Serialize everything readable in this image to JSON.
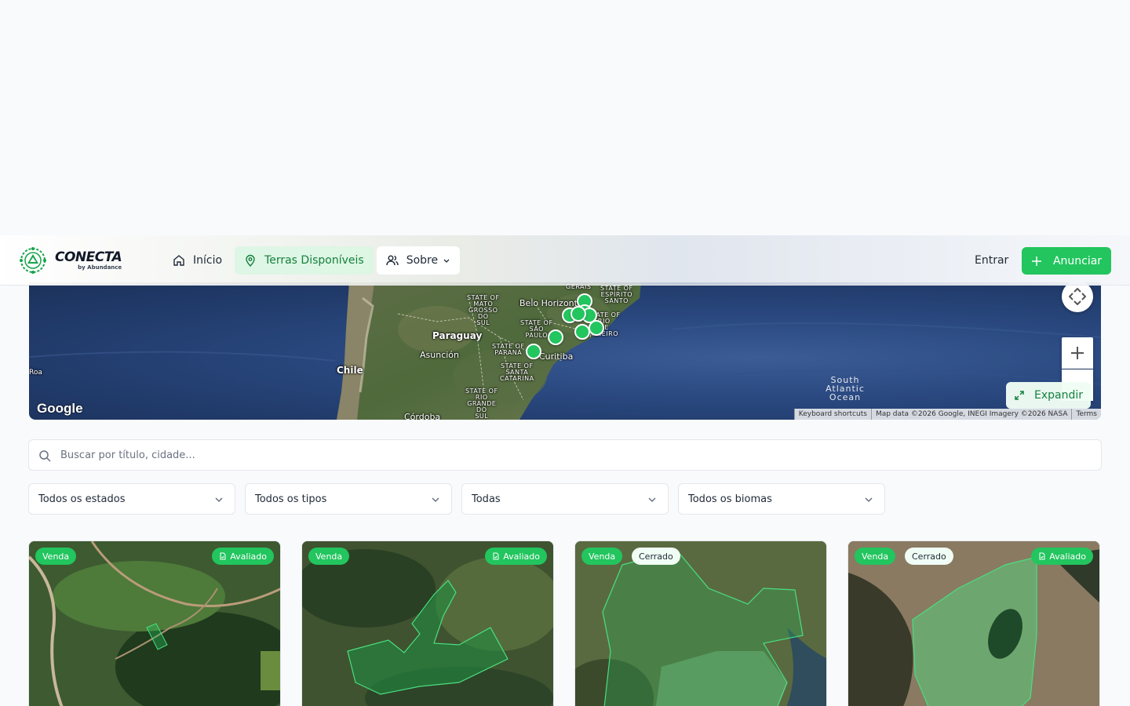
{
  "brand": {
    "name": "CONECTA",
    "subtitle": "by Abundance"
  },
  "nav": {
    "inicio": "Início",
    "terras": "Terras Disponíveis",
    "sobre": "Sobre",
    "entrar": "Entrar",
    "anunciar": "Anunciar"
  },
  "map": {
    "labels": {
      "paraguay": "Paraguay",
      "chile": "Chile",
      "asuncion": "Asunción",
      "curitiba": "Curitiba",
      "belo_horizonte": "Belo Horizonte",
      "cordoba": "Córdoba",
      "roa": "Roa",
      "gerais": "GERAIS",
      "state_mato_grosso_do_sul": "STATE OF MATO GROSSO DO SUL",
      "state_espirito_santo": "STATE OF ESPÍRITO SANTO",
      "state_sao_paulo": "STATE OF SÃO PAULO",
      "state_rio_de_janeiro": "STATE OF RIO DE JANEIRO",
      "state_parana": "STATE OF PARANÁ",
      "state_santa_catarina": "STATE OF SANTA CATARINA",
      "state_rio_grande_do_sul": "STATE OF RIO GRANDE DO SUL",
      "south_atlantic_ocean": "South Atlantic Ocean"
    },
    "google": "Google",
    "attribution": {
      "shortcuts": "Keyboard shortcuts",
      "data": "Map data ©2026 Google, INEGI Imagery ©2026 NASA",
      "terms": "Terms"
    },
    "expand_label": "Expandir",
    "marker_color": "#22c55e"
  },
  "search": {
    "placeholder": "Buscar por título, cidade..."
  },
  "filters": {
    "estados": "Todos os estados",
    "tipos": "Todos os tipos",
    "todas": "Todas",
    "biomas": "Todos os biomas"
  },
  "cards": [
    {
      "type": "Venda",
      "avaliado": "Avaliado"
    },
    {
      "type": "Venda",
      "avaliado": "Avaliado"
    },
    {
      "type": "Venda",
      "bioma": "Cerrado"
    },
    {
      "type": "Venda",
      "bioma": "Cerrado",
      "avaliado": "Avaliado"
    }
  ],
  "colors": {
    "accent": "#22c55e",
    "accent_dark": "#15803d"
  }
}
